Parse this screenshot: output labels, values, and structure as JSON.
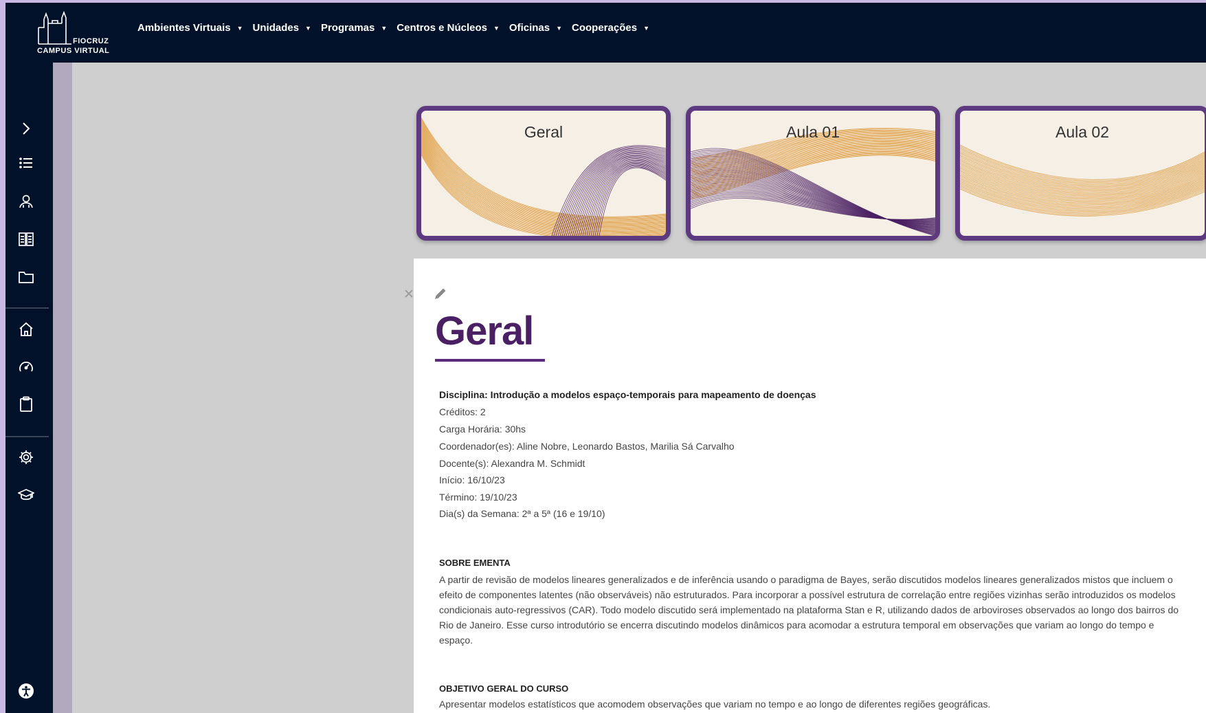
{
  "logo": {
    "line1": "FIOCRUZ",
    "line2": "CAMPUS VIRTUAL"
  },
  "nav": {
    "items": [
      {
        "label": "Ambientes Virtuais"
      },
      {
        "label": "Unidades"
      },
      {
        "label": "Programas"
      },
      {
        "label": "Centros e Núcleos"
      },
      {
        "label": "Oficinas"
      },
      {
        "label": "Cooperações"
      }
    ]
  },
  "sidebar": {
    "icons": [
      "chevron-right-icon",
      "list-icon",
      "users-icon",
      "book-icon",
      "folder-icon",
      "home-icon",
      "dashboard-icon",
      "clipboard-icon",
      "gear-icon",
      "graduation-cap-icon",
      "accessibility-icon"
    ]
  },
  "cards": [
    {
      "title": "Geral"
    },
    {
      "title": "Aula 01"
    },
    {
      "title": "Aula 02"
    }
  ],
  "colors": {
    "navbar": "#02112a",
    "accent": "#5d3a7f",
    "title": "#4a1f63",
    "wave_orange": "#d98a1a",
    "wave_purple": "#4a1f63"
  },
  "section": {
    "title": "Geral",
    "discipline": "Disciplina: Introdução a modelos espaço-temporais para mapeamento de doenças",
    "credits": "Créditos: 2",
    "hours": "Carga Horária: 30hs",
    "coordinators": "Coordenador(es): Aline Nobre, Leonardo Bastos, Marilia Sá Carvalho",
    "teachers": "Docente(s):  Alexandra M. Schmidt",
    "start": "Início:  16/10/23",
    "end": "Término:  19/10/23",
    "days": "Dia(s) da Semana: 2ª a 5ª (16 e 19/10)",
    "ementa_heading": "SOBRE EMENTA",
    "ementa_text": "A partir de revisão de modelos lineares generalizados e de inferência usando o paradigma de Bayes, serão discutidos modelos lineares generalizados mistos que incluem o efeito de componentes latentes (não observáveis) não estruturados. Para incorporar a possível estrutura de correlação entre regiões vizinhas serão introduzidos os modelos condicionais auto-regressivos (CAR). Todo modelo discutido será implementado na plataforma Stan e R, utilizando dados de arboviroses observados ao longo dos bairros do Rio de Janeiro. Esse curso introdutório se encerra discutindo modelos dinâmicos para acomodar a estrutura temporal em observações que variam ao longo do tempo e espaço.",
    "objective_heading": "OBJETIVO GERAL DO CURSO",
    "objective_text": "Apresentar modelos estatísticos que acomodem observações que variam no tempo e ao longo de diferentes regiões geográficas."
  }
}
